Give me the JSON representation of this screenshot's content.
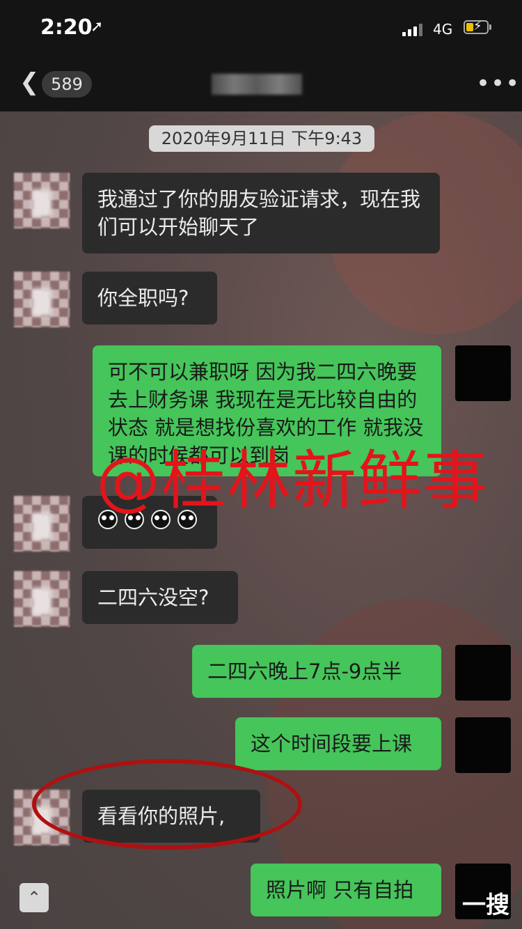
{
  "status_bar": {
    "time": "2:20",
    "network": "4G",
    "location_icon": "location-arrow-icon"
  },
  "header": {
    "back_icon": "chevron-left-icon",
    "unread_count": "589",
    "more_icon": "more-dots-icon"
  },
  "chat": {
    "timestamp": "2020年9月11日 下午9:43",
    "messages": [
      {
        "sender": "them",
        "text": "我通过了你的朋友验证请求，现在我们可以开始聊天了"
      },
      {
        "sender": "them",
        "text": "你全职吗?"
      },
      {
        "sender": "me",
        "text": "可不可以兼职呀 因为我二四六晚要去上财务课 我现在是无比较自由的状态 就是想找份喜欢的工作 就我没课的时候都可以到岗"
      },
      {
        "sender": "them",
        "text": "",
        "emoji_count": 4,
        "emoji_icon": "smirk-face-icon"
      },
      {
        "sender": "them",
        "text": "二四六没空?"
      },
      {
        "sender": "me",
        "text": "二四六晚上7点-9点半"
      },
      {
        "sender": "me",
        "text": "这个时间段要上课"
      },
      {
        "sender": "them",
        "text": "看看你的照片,"
      },
      {
        "sender": "me",
        "text": "照片啊 只有自拍"
      }
    ]
  },
  "overlay": {
    "watermark": "@桂林新鲜事",
    "corner_tag": "一搜",
    "highlight_color": "#b01010",
    "watermark_color": "#e3141b"
  },
  "colors": {
    "my_bubble": "#45c55a",
    "their_bubble": "#2b2b2b"
  }
}
